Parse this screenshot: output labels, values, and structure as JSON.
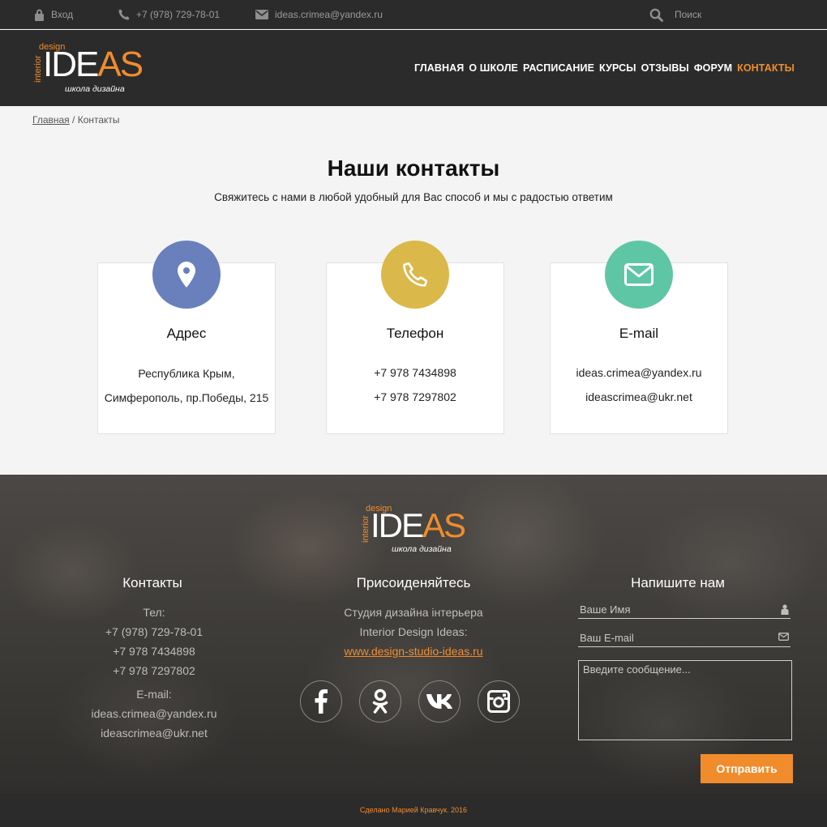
{
  "topbar": {
    "login": "Вход",
    "phone": "+7 (978) 729-78-01",
    "email": "ideas.crimea@yandex.ru",
    "search": "Поиск"
  },
  "logo": {
    "design": "design",
    "interior": "interior",
    "ide": "IDE",
    "as": "AS",
    "school": "школа дизайна"
  },
  "nav": [
    {
      "label": "ГЛАВНАЯ",
      "active": false
    },
    {
      "label": "О ШКОЛЕ",
      "active": false
    },
    {
      "label": "РАСПИСАНИЕ",
      "active": false
    },
    {
      "label": "КУРСЫ",
      "active": false
    },
    {
      "label": "ОТЗЫВЫ",
      "active": false
    },
    {
      "label": "ФОРУМ",
      "active": false
    },
    {
      "label": "КОНТАКТЫ",
      "active": true
    }
  ],
  "breadcrumb": {
    "home": "Главная",
    "separator": "/",
    "current": "Контакты"
  },
  "page": {
    "title": "Наши контакты",
    "subtitle": "Свяжитесь с нами в любой удобный для Вас способ и мы с радостью ответим"
  },
  "cards": [
    {
      "title": "Адрес",
      "lines": [
        "Республика Крым,",
        "Симферополь, пр.Победы, 215"
      ],
      "color": "#6980bd",
      "icon": "map-pin-icon"
    },
    {
      "title": "Телефон",
      "lines": [
        "+7 978 7434898",
        "+7 978 7297802"
      ],
      "color": "#dab84a",
      "icon": "phone-icon"
    },
    {
      "title": "E-mail",
      "lines": [
        "ideas.crimea@yandex.ru",
        "ideascrimea@ukr.net"
      ],
      "color": "#5fc6a5",
      "icon": "envelope-icon"
    }
  ],
  "footer": {
    "contacts": {
      "title": "Контакты",
      "tel_label": "Тел:",
      "phones": [
        "+7 (978) 729-78-01",
        "+7 978 7434898",
        "+7 978 7297802"
      ],
      "email_label": "E-mail:",
      "emails": [
        "ideas.crimea@yandex.ru",
        "ideascrimea@ukr.net"
      ]
    },
    "join": {
      "title": "Присоиденяйтесь",
      "line1": "Студия дизайна інтерьера",
      "line2": "Interior Design Ideas:",
      "link": "www.design-studio-ideas.ru",
      "social": [
        "facebook-icon",
        "odnoklassniki-icon",
        "vk-icon",
        "instagram-icon"
      ]
    },
    "form": {
      "title": "Напишите нам",
      "name_placeholder": "Ваше Имя",
      "email_placeholder": "Ваш E-mail",
      "message_placeholder": "Введите сообщение...",
      "submit": "Отправить"
    },
    "copyright": "Сделано Марией Кравчук. 2016"
  },
  "colors": {
    "accent": "#f08c2c",
    "dark": "#2b2b2b"
  }
}
